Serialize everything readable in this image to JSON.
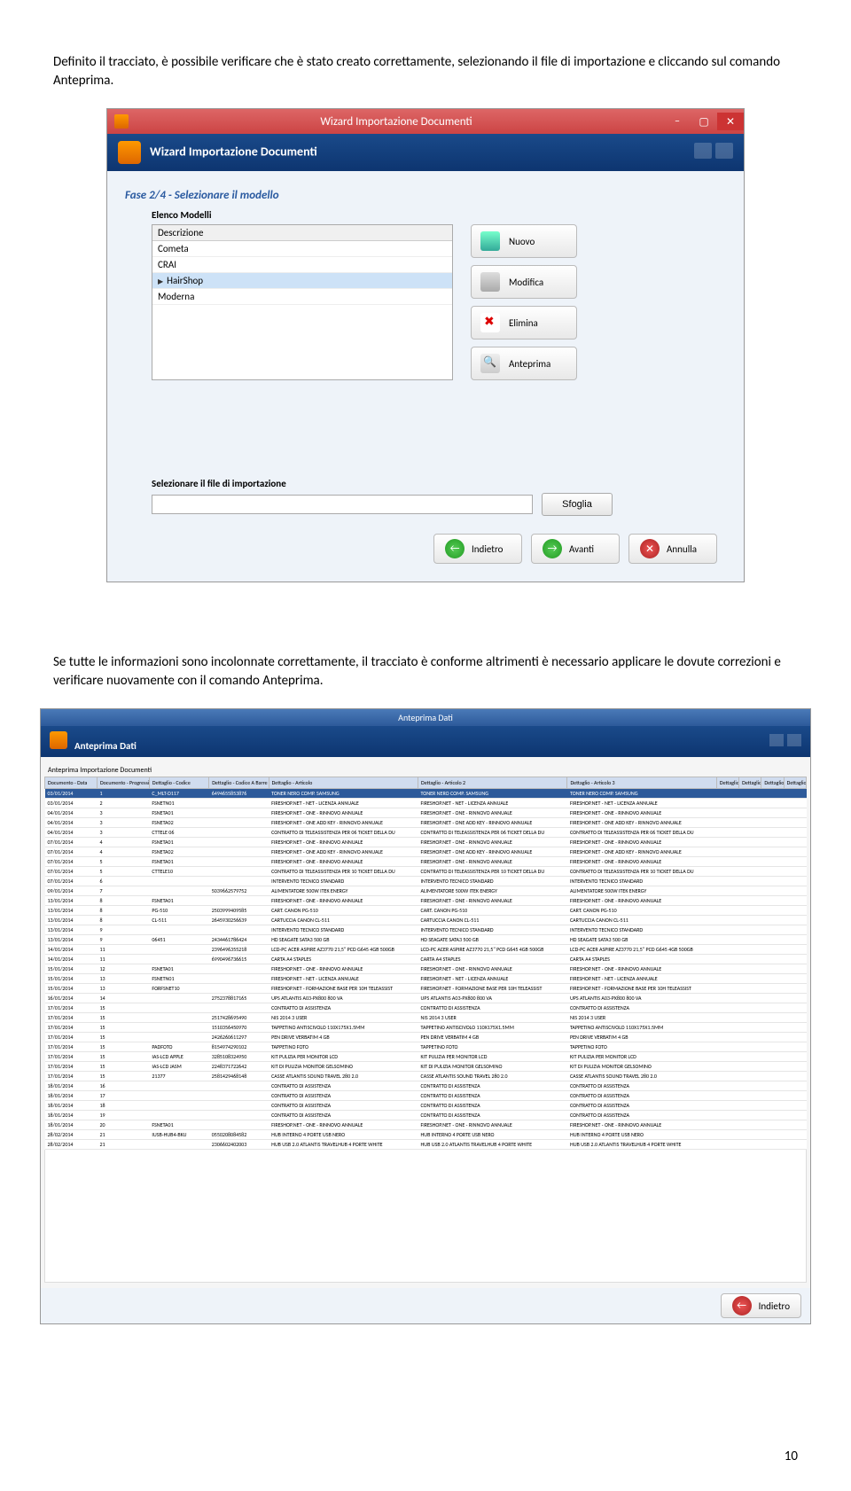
{
  "intro_paragraph": "Definito il tracciato, è possibile verificare che è stato creato correttamente, selezionando il file di importazione e cliccando sul comando Anteprima.",
  "second_paragraph": "Se tutte le informazioni sono incolonnate correttamente, il tracciato è conforme altrimenti è necessario applicare le dovute correzioni e verificare nuovamente con il comando Anteprima.",
  "page_number": "10",
  "window1": {
    "title": "Wizard Importazione Documenti",
    "header_title": "Wizard Importazione Documenti",
    "phase": "Fase 2/4 - Selezionare il modello",
    "list_label": "Elenco Modelli",
    "list_header": "Descrizione",
    "rows": [
      "Cometa",
      "CRAI",
      "HairShop",
      "Moderna"
    ],
    "selected_index": 2,
    "buttons": {
      "nuovo": "Nuovo",
      "modifica": "Modifica",
      "elimina": "Elimina",
      "anteprima": "Anteprima"
    },
    "file_label": "Selezionare il file di importazione",
    "sfoglia": "Sfoglia",
    "nav": {
      "indietro": "Indietro",
      "avanti": "Avanti",
      "annulla": "Annulla"
    }
  },
  "window2": {
    "title": "Anteprima Dati",
    "header_title": "Anteprima Dati",
    "breadcrumb": "Anteprima Importazione Documenti",
    "columns": [
      "Documento - Data",
      "Documento - Progressivo",
      "Dettaglio - Codice",
      "Dettaglio - Codice A Barre",
      "Dettaglio - Articolo",
      "Dettaglio - Articolo 2",
      "Dettaglio - Articolo 3",
      "Dettaglio - UM",
      "Dettaglio - Quantità",
      "Dettaglio - Importo Unitario",
      "Dettaglio - Aliquota"
    ],
    "rows": [
      [
        "03/01/2014",
        "1",
        "C_MLT-D117",
        "6494655853876",
        "TONER NERO COMP. SAMSUNG",
        "TONER NERO COMP. SAMSUNG",
        "TONER NERO COMP. SAMSUNG",
        "",
        "",
        "",
        ""
      ],
      [
        "03/01/2014",
        "2",
        "FSNETN01",
        "",
        "FIRESHOP.NET - NET - LICENZA ANNUALE",
        "FIRESHOP.NET - NET - LICENZA ANNUALE",
        "FIRESHOP.NET - NET - LICENZA ANNUALE",
        "",
        "",
        "",
        ""
      ],
      [
        "04/01/2014",
        "3",
        "FSNETA01",
        "",
        "FIRESHOP.NET - ONE - RINNOVO ANNUALE",
        "FIRESHOP.NET - ONE - RINNOVO ANNUALE",
        "FIRESHOP.NET - ONE - RINNOVO ANNUALE",
        "",
        "",
        "",
        ""
      ],
      [
        "04/01/2014",
        "3",
        "FSNETA02",
        "",
        "FIRESHOP.NET - ONE ADD KEY - RINNOVO ANNUALE",
        "FIRESHOP.NET - ONE ADD KEY - RINNOVO ANNUALE",
        "FIRESHOP.NET - ONE ADD KEY - RINNOVO ANNUALE",
        "",
        "",
        "",
        ""
      ],
      [
        "04/01/2014",
        "3",
        "CTTELE 06",
        "",
        "CONTRATTO DI TELEASSISTENZA PER 06 TICKET DELLA DU",
        "CONTRATTO DI TELEASSISTENZA PER 06 TICKET DELLA DU",
        "CONTRATTO DI TELEASSISTENZA PER 06 TICKET DELLA DU",
        "",
        "",
        "",
        ""
      ],
      [
        "07/01/2014",
        "4",
        "FSNETA01",
        "",
        "FIRESHOP.NET - ONE - RINNOVO ANNUALE",
        "FIRESHOP.NET - ONE - RINNOVO ANNUALE",
        "FIRESHOP.NET - ONE - RINNOVO ANNUALE",
        "",
        "",
        "",
        ""
      ],
      [
        "07/01/2014",
        "4",
        "FSNETA02",
        "",
        "FIRESHOP.NET - ONE ADD KEY - RINNOVO ANNUALE",
        "FIRESHOP.NET - ONE ADD KEY - RINNOVO ANNUALE",
        "FIRESHOP.NET - ONE ADD KEY - RINNOVO ANNUALE",
        "",
        "",
        "",
        ""
      ],
      [
        "07/01/2014",
        "5",
        "FSNETA01",
        "",
        "FIRESHOP.NET - ONE - RINNOVO ANNUALE",
        "FIRESHOP.NET - ONE - RINNOVO ANNUALE",
        "FIRESHOP.NET - ONE - RINNOVO ANNUALE",
        "",
        "",
        "",
        ""
      ],
      [
        "07/01/2014",
        "5",
        "CTTELE10",
        "",
        "CONTRATTO DI TELEASSISTENZA PER 10 TICKET DELLA DU",
        "CONTRATTO DI TELEASSISTENZA PER 10 TICKET DELLA DU",
        "CONTRATTO DI TELEASSISTENZA PER 10 TICKET DELLA DU",
        "",
        "",
        "",
        ""
      ],
      [
        "07/01/2014",
        "6",
        "",
        "",
        "INTERVENTO TECNICO STANDARD",
        "INTERVENTO TECNICO STANDARD",
        "INTERVENTO TECNICO STANDARD",
        "",
        "",
        "",
        ""
      ],
      [
        "09/01/2014",
        "7",
        "",
        "5039662579752",
        "ALIMENTATORE 500W ITEK ENERGY",
        "ALIMENTATORE 500W ITEK ENERGY",
        "ALIMENTATORE 500W ITEK ENERGY",
        "",
        "",
        "",
        ""
      ],
      [
        "13/01/2014",
        "8",
        "FSNETA01",
        "",
        "FIRESHOP.NET - ONE - RINNOVO ANNUALE",
        "FIRESHOP.NET - ONE - RINNOVO ANNUALE",
        "FIRESHOP.NET - ONE - RINNOVO ANNUALE",
        "",
        "",
        "",
        ""
      ],
      [
        "13/01/2014",
        "8",
        "PG-510",
        "2503999409585",
        "CART. CANON PG-510",
        "CART. CANON PG-510",
        "CART. CANON PG-510",
        "",
        "",
        "",
        ""
      ],
      [
        "13/01/2014",
        "8",
        "CL-511",
        "2645930256639",
        "CARTUCCIA CANON CL-511",
        "CARTUCCIA CANON CL-511",
        "CARTUCCIA CANON CL-511",
        "",
        "",
        "",
        ""
      ],
      [
        "13/01/2014",
        "9",
        "",
        "",
        "INTERVENTO TECNICO STANDARD",
        "INTERVENTO TECNICO STANDARD",
        "INTERVENTO TECNICO STANDARD",
        "",
        "",
        "",
        ""
      ],
      [
        "13/01/2014",
        "9",
        "06451",
        "2434461786424",
        "HD SEAGATE SATA3 500 GB",
        "HD SEAGATE SATA3 500 GB",
        "HD SEAGATE SATA3 500 GB",
        "",
        "",
        "",
        ""
      ],
      [
        "14/01/2014",
        "11",
        "",
        "2396496355218",
        "LCD-PC ACER ASPIRE AZ3770 21,5\" PCD G645 4GB 500GB",
        "LCD-PC ACER ASPIRE AZ3770 21,5\" PCD G645 4GB 500GB",
        "LCD-PC ACER ASPIRE AZ3770 21,5\" PCD G645 4GB 500GB",
        "",
        "",
        "",
        ""
      ],
      [
        "14/01/2014",
        "11",
        "",
        "6990496736615",
        "CARTA A4 STAPLES",
        "CARTA A4 STAPLES",
        "CARTA A4 STAPLES",
        "",
        "",
        "",
        ""
      ],
      [
        "15/01/2014",
        "12",
        "FSNETA01",
        "",
        "FIRESHOP.NET - ONE - RINNOVO ANNUALE",
        "FIRESHOP.NET - ONE - RINNOVO ANNUALE",
        "FIRESHOP.NET - ONE - RINNOVO ANNUALE",
        "",
        "",
        "",
        ""
      ],
      [
        "15/01/2014",
        "13",
        "FSNETN01",
        "",
        "FIRESHOP.NET - NET - LICENZA ANNUALE",
        "FIRESHOP.NET - NET - LICENZA ANNUALE",
        "FIRESHOP.NET - NET - LICENZA ANNUALE",
        "",
        "",
        "",
        ""
      ],
      [
        "15/01/2014",
        "13",
        "FORFSNET10",
        "",
        "FIRESHOP.NET - FORMAZIONE BASE PER 10H TELEASSIST",
        "FIRESHOP.NET - FORMAZIONE BASE PER 10H TELEASSIST",
        "FIRESHOP.NET - FORMAZIONE BASE PER 10H TELEASSIST",
        "",
        "",
        "",
        ""
      ],
      [
        "16/01/2014",
        "14",
        "",
        "2752378817165",
        "UPS ATLANTIS A03-PX800 800 VA",
        "UPS ATLANTIS A03-PX800 800 VA",
        "UPS ATLANTIS A03-PX800 800 VA",
        "",
        "",
        "",
        ""
      ],
      [
        "17/01/2014",
        "15",
        "",
        "",
        "CONTRATTO DI ASSISTENZA",
        "CONTRATTO DI ASSISTENZA",
        "CONTRATTO DI ASSISTENZA",
        "",
        "",
        "",
        ""
      ],
      [
        "17/01/2014",
        "15",
        "",
        "2517428695490",
        "NIS 2014 3 USER",
        "NIS 2014 3 USER",
        "NIS 2014 3 USER",
        "",
        "",
        "",
        ""
      ],
      [
        "17/01/2014",
        "15",
        "",
        "1510356450970",
        "TAPPETINO ANTISCIVOLO 110X175X1.5MM",
        "TAPPETINO ANTISCIVOLO 110X175X1.5MM",
        "TAPPETINO ANTISCIVOLO 110X175X1.5MM",
        "",
        "",
        "",
        ""
      ],
      [
        "17/01/2014",
        "15",
        "",
        "2426260611297",
        "PEN DRIVE VERBATIM 4 GB",
        "PEN DRIVE VERBATIM 4 GB",
        "PEN DRIVE VERBATIM 4 GB",
        "",
        "",
        "",
        ""
      ],
      [
        "17/01/2014",
        "15",
        "PADFOTO",
        "8154974290102",
        "TAPPETINO FOTO",
        "TAPPETINO FOTO",
        "TAPPETINO FOTO",
        "",
        "",
        "",
        ""
      ],
      [
        "17/01/2014",
        "15",
        "IAS-LCD APPLE",
        "3285108324950",
        "KIT PULIZIA PER MONITOR LCD",
        "KIT PULIZIA PER MONITOR LCD",
        "KIT PULIZIA PER MONITOR LCD",
        "",
        "",
        "",
        ""
      ],
      [
        "17/01/2014",
        "15",
        "IAS-LCD JASM",
        "2248371722642",
        "KIT DI PULIZIA MONITOR GELSOMINO",
        "KIT DI PULIZIA MONITOR GELSOMINO",
        "KIT DI PULIZIA MONITOR GELSOMINO",
        "",
        "",
        "",
        ""
      ],
      [
        "17/01/2014",
        "15",
        "21377",
        "2581429468148",
        "CASSE ATLANTIS SOUND TRAVEL 280 2.0",
        "CASSE ATLANTIS SOUND TRAVEL 280 2.0",
        "CASSE ATLANTIS SOUND TRAVEL 280 2.0",
        "",
        "",
        "",
        ""
      ],
      [
        "18/01/2014",
        "16",
        "",
        "",
        "CONTRATTO DI ASSISTENZA",
        "CONTRATTO DI ASSISTENZA",
        "CONTRATTO DI ASSISTENZA",
        "",
        "",
        "",
        ""
      ],
      [
        "18/01/2014",
        "17",
        "",
        "",
        "CONTRATTO DI ASSISTENZA",
        "CONTRATTO DI ASSISTENZA",
        "CONTRATTO DI ASSISTENZA",
        "",
        "",
        "",
        ""
      ],
      [
        "18/01/2014",
        "18",
        "",
        "",
        "CONTRATTO DI ASSISTENZA",
        "CONTRATTO DI ASSISTENZA",
        "CONTRATTO DI ASSISTENZA",
        "",
        "",
        "",
        ""
      ],
      [
        "18/01/2014",
        "19",
        "",
        "",
        "CONTRATTO DI ASSISTENZA",
        "CONTRATTO DI ASSISTENZA",
        "CONTRATTO DI ASSISTENZA",
        "",
        "",
        "",
        ""
      ],
      [
        "18/01/2014",
        "20",
        "FSNETA01",
        "",
        "FIRESHOP.NET - ONE - RINNOVO ANNUALE",
        "FIRESHOP.NET - ONE - RINNOVO ANNUALE",
        "FIRESHOP.NET - ONE - RINNOVO ANNUALE",
        "",
        "",
        "",
        ""
      ],
      [
        "28/02/2014",
        "21",
        "IUSB-HUB4-BKU",
        "0550208084582",
        "HUB INTERNO 4 PORTE USB NERO",
        "HUB INTERNO 4 PORTE USB NERO",
        "HUB INTERNO 4 PORTE USB NERO",
        "",
        "",
        "",
        ""
      ],
      [
        "28/02/2014",
        "21",
        "",
        "2306602402003",
        "HUB USB 2.0 ATLANTIS TRAVELHUB 4 PORTE WHITE",
        "HUB USB 2.0 ATLANTIS TRAVELHUB 4 PORTE WHITE",
        "HUB USB 2.0 ATLANTIS TRAVELHUB 4 PORTE WHITE",
        "",
        "",
        "",
        ""
      ]
    ],
    "indietro": "Indietro"
  }
}
